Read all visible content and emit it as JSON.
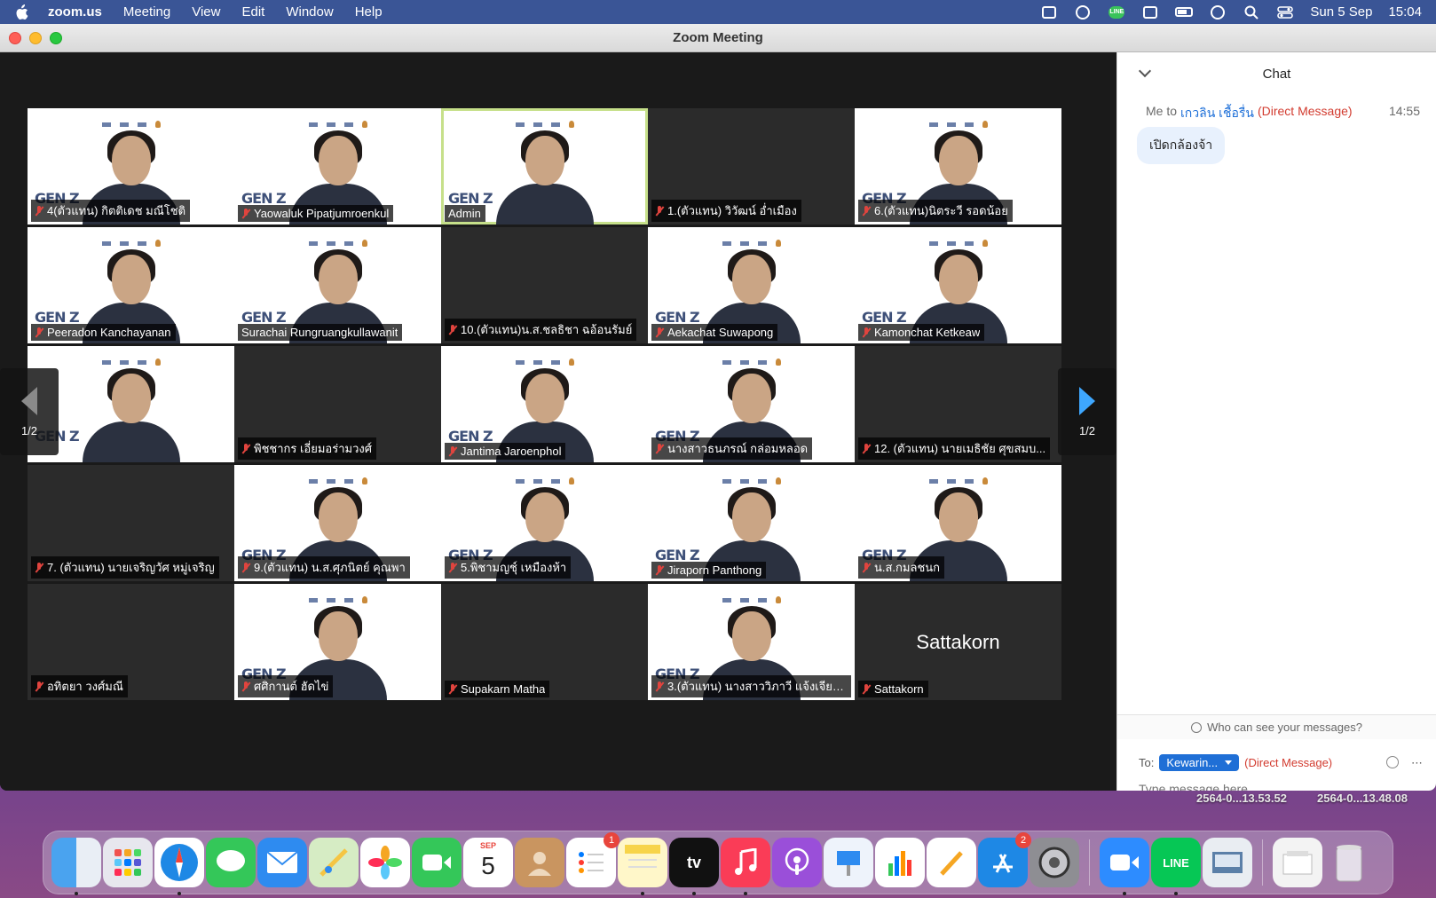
{
  "menubar": {
    "app_name": "zoom.us",
    "menus": [
      "Meeting",
      "View",
      "Edit",
      "Window",
      "Help"
    ],
    "date": "Sun 5 Sep",
    "time": "15:04"
  },
  "window": {
    "title": "Zoom Meeting"
  },
  "gallery": {
    "page_indicator_left": "1/2",
    "page_indicator_right": "1/2",
    "tiles": [
      {
        "name": "4(ตัวแทน) กิตติเดช มณีโชติ",
        "video": true,
        "muted": true
      },
      {
        "name": "Yaowaluk Pipatjumroenkul",
        "video": true,
        "muted": true
      },
      {
        "name": "Admin",
        "video": true,
        "muted": false,
        "active": true
      },
      {
        "name": "1.(ตัวแทน) วิวัฒน์ อ่ำเมือง",
        "video": false,
        "muted": true
      },
      {
        "name": "6.(ตัวแทน)นิตระวี รอดน้อย",
        "video": true,
        "muted": true
      },
      {
        "name": "Peeradon Kanchayanan",
        "video": true,
        "muted": true
      },
      {
        "name": "Surachai Rungruangkullawanit",
        "video": true,
        "muted": false
      },
      {
        "name": "10.(ตัวแทน)น.ส.ชลธิชา ฉอ้อนรัมย์",
        "video": false,
        "muted": true
      },
      {
        "name": "Aekachat Suwapong",
        "video": true,
        "muted": true
      },
      {
        "name": "Kamonchat Ketkeaw",
        "video": true,
        "muted": true
      },
      {
        "name": "",
        "video": true,
        "muted": false
      },
      {
        "name": "พิชชากร เอี่ยมอร่ามวงศ์",
        "video": false,
        "muted": true
      },
      {
        "name": "Jantima Jaroenphol",
        "video": true,
        "muted": true
      },
      {
        "name": "นางสาวธนภรณ์ กล่อมหลอด",
        "video": true,
        "muted": true
      },
      {
        "name": "12. (ตัวแทน) นายเมธิชัย ศุขสมบ...",
        "video": false,
        "muted": true
      },
      {
        "name": "7. (ตัวแทน) นายเจริญวัศ หมู่เจริญ",
        "video": false,
        "muted": true
      },
      {
        "name": "9.(ตัวแทน) น.ส.ศุภนิตย์ คุณพา",
        "video": true,
        "muted": true
      },
      {
        "name": "5.พิชามญชุ์ เหมืองห้า",
        "video": true,
        "muted": true
      },
      {
        "name": "Jiraporn Panthong",
        "video": true,
        "muted": true
      },
      {
        "name": "น.ส.กมลชนก",
        "video": true,
        "muted": true
      },
      {
        "name": "อทิตยา วงศ์มณี",
        "video": false,
        "muted": true
      },
      {
        "name": "ศศิกานต์ ฮัดไข่",
        "video": true,
        "muted": true
      },
      {
        "name": "Supakarn Matha",
        "video": false,
        "muted": true
      },
      {
        "name": "3.(ตัวแทน) นางสาววิภาวี แจ้งเจียน...",
        "video": true,
        "muted": true
      },
      {
        "name": "Sattakorn",
        "video": false,
        "muted": true,
        "big_name": "Sattakorn"
      }
    ]
  },
  "chat": {
    "title": "Chat",
    "message": {
      "from": "Me to",
      "to": "เกวลิน เชื้อรื่น",
      "tag": "(Direct Message)",
      "time": "14:55",
      "text": "เปิดกล้องจ้า"
    },
    "who_can_see": "Who can see your messages?",
    "to_label": "To:",
    "recipient": "Kewarin...",
    "recipient_tag": "(Direct Message)",
    "input_placeholder": "Type message here..."
  },
  "desktop_files": [
    "2564-0...13.53.52",
    "2564-0...13.48.08"
  ],
  "dock": {
    "calendar_month": "SEP",
    "calendar_day": "5",
    "reminders_badge": "1",
    "appstore_badge": "2",
    "tv_label": "tv",
    "line_label": "LINE"
  }
}
